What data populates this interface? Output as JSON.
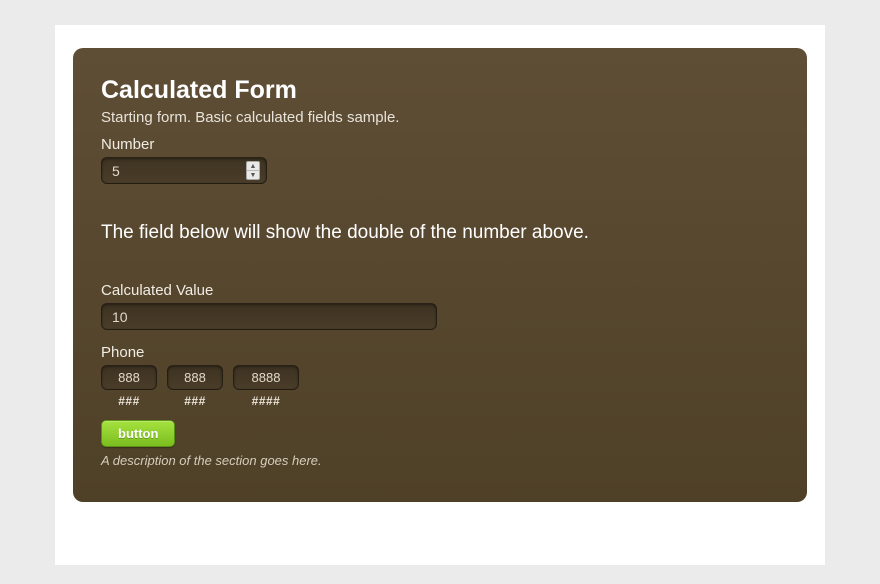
{
  "form": {
    "title": "Calculated Form",
    "subtitle": "Starting form. Basic calculated fields sample.",
    "number_field": {
      "label": "Number",
      "value": "5"
    },
    "info_text": "The field below will show the double of the number above.",
    "calculated_field": {
      "label": "Calculated Value",
      "value": "10"
    },
    "phone": {
      "label": "Phone",
      "segments": [
        {
          "value": "888",
          "hint": "###"
        },
        {
          "value": "888",
          "hint": "###"
        },
        {
          "value": "8888",
          "hint": "####"
        }
      ]
    },
    "submit": {
      "label": "button"
    },
    "footer_description": "A description of the section goes here."
  }
}
